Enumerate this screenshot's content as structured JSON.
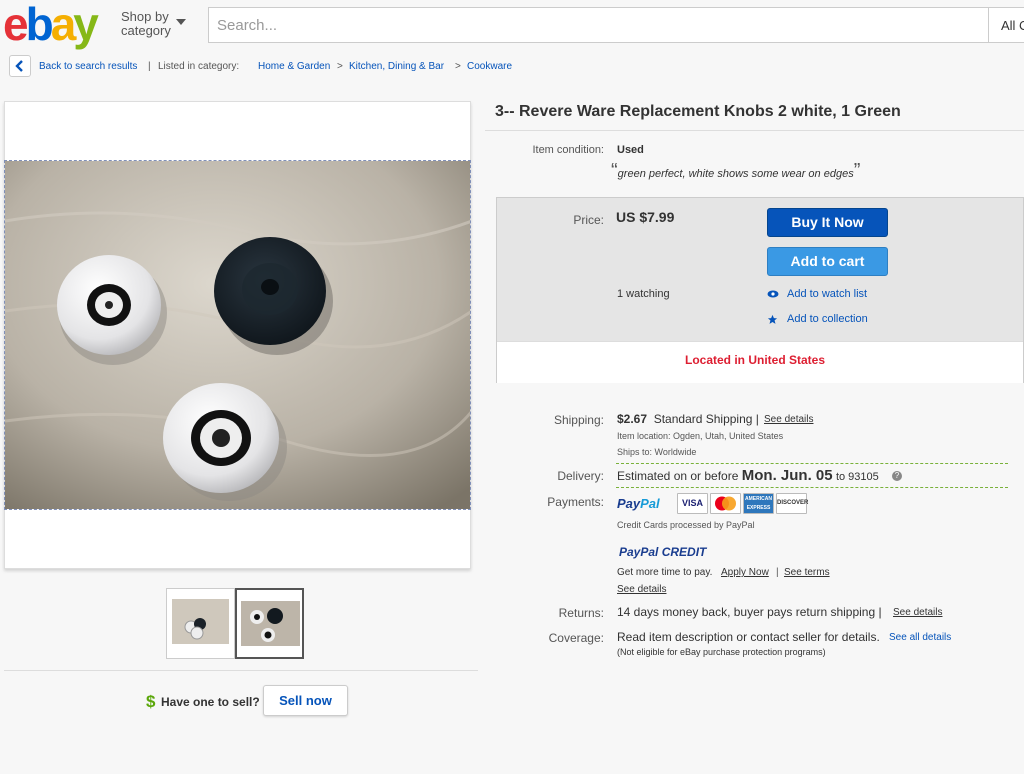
{
  "header": {
    "logo": {
      "e": "e",
      "b": "b",
      "a": "a",
      "y": "y"
    },
    "shop_by_line1": "Shop by",
    "shop_by_line2": "category",
    "search_placeholder": "Search...",
    "category_select": "All C"
  },
  "breadcrumb": {
    "back_label": "Back to search results",
    "separator": "|",
    "listed_in": "Listed in category:",
    "crumbs": [
      "Home & Garden",
      "Kitchen, Dining & Bar",
      "Cookware"
    ],
    "arrow": ">"
  },
  "gallery": {
    "thumbnail_count": 2,
    "selected_thumbnail": 2
  },
  "sell": {
    "dollar": "$",
    "have_one": "Have one to sell?",
    "sell_now": "Sell now"
  },
  "item": {
    "title": "3-- Revere Ware Replacement Knobs 2 white, 1 Green",
    "condition_label": "Item condition:",
    "condition_value": "Used",
    "quote_open": "“",
    "condition_note": "green perfect, white shows some wear on edges",
    "quote_close": "”"
  },
  "purchase": {
    "price_label": "Price:",
    "price": "US $7.99",
    "buy_now": "Buy It Now",
    "add_to_cart": "Add to cart",
    "watching": "1 watching",
    "add_watch": "Add to watch list",
    "add_collection": "Add to collection",
    "located": "Located in United States"
  },
  "shipping": {
    "label": "Shipping:",
    "cost": "$2.67",
    "method": "Standard Shipping",
    "sep": "|",
    "see_details": "See details",
    "item_location": "Item location:  Ogden, Utah, United States",
    "ships_to": "Ships to:  Worldwide"
  },
  "delivery": {
    "label": "Delivery:",
    "prefix": "Estimated on or before",
    "date": "Mon. Jun. 05",
    "to": "to 93105",
    "help": "?"
  },
  "payments": {
    "label": "Payments:",
    "paypal1": "Pay",
    "paypal2": "Pal",
    "cards": [
      "VISA",
      "MasterCard",
      "AMERICAN EXPRESS",
      "DISCOVER"
    ],
    "cards_note": "Credit Cards processed by PayPal",
    "credit_pay": "PayPal",
    "credit_word": "CREDIT",
    "more_time": "Get more time to pay.",
    "apply_now": "Apply Now",
    "sep": "|",
    "see_terms": "See terms",
    "see_details": "See details"
  },
  "returns": {
    "label": "Returns:",
    "text": "14 days money back, buyer pays return shipping",
    "sep": "|",
    "see_details": "See details"
  },
  "coverage": {
    "label": "Coverage:",
    "text": "Read item description or contact seller for details.",
    "see_all": "See all details",
    "note": "(Not eligible for eBay purchase protection programs)"
  },
  "colors": {
    "link": "#0654ba",
    "buy_now": "#0654ba",
    "add_to_cart": "#3a99e4",
    "located": "#dd1e31",
    "dashed": "#79b13a"
  }
}
